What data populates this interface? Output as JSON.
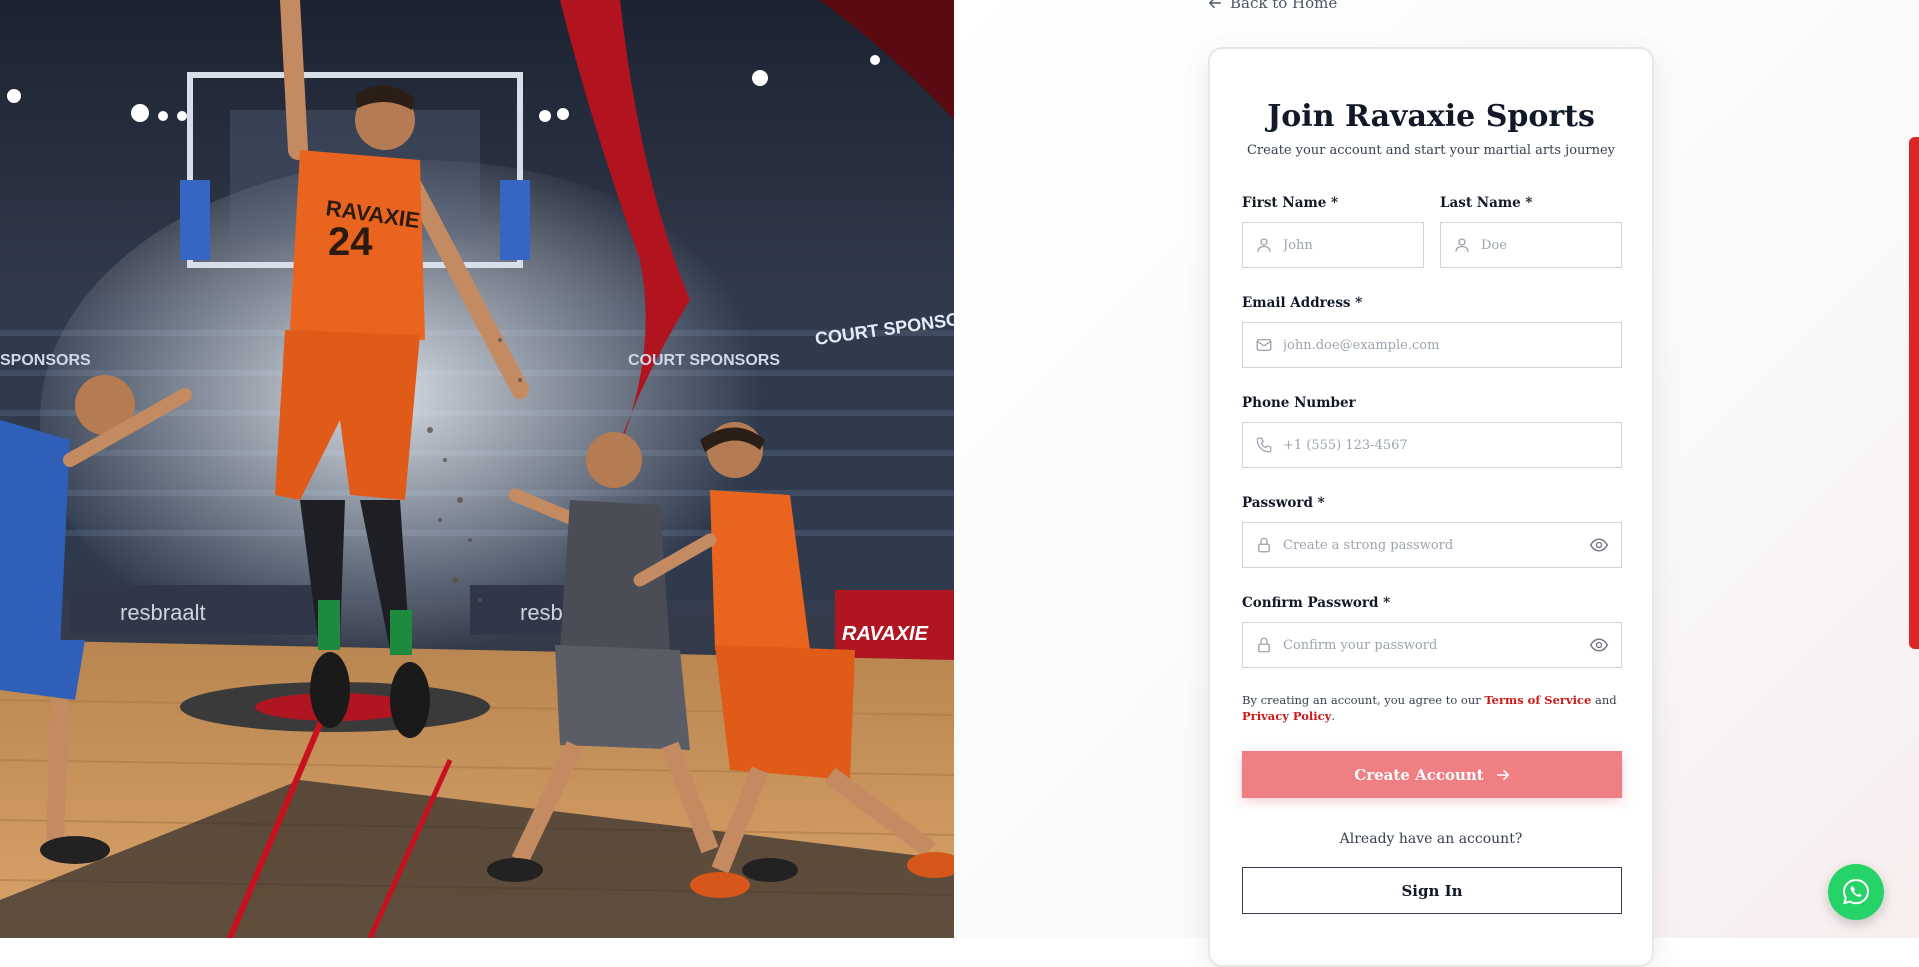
{
  "hero": {
    "jersey_text": "RAVAXIE",
    "jersey_number": "24",
    "banner_court_sponsors": "COURT SPONSORS",
    "banner_court_sponsors_2": "COURT SPONSORS",
    "banner_sponsors_left": "SPONSORS",
    "court_ad_1": "resbraalt",
    "court_ad_2": "resbr",
    "court_ad_3": "RAVAXIE",
    "colors": {
      "accent_red": "#dc2626",
      "jersey_orange": "#e8641f",
      "court_wood": "#c8935a"
    }
  },
  "nav": {
    "back_label": "Back to Home",
    "back_icon": "arrow-left-icon"
  },
  "form": {
    "title": "Join Ravaxie Sports",
    "subtitle": "Create your account and start your martial arts journey",
    "first_name": {
      "label": "First Name *",
      "placeholder": "John",
      "icon": "user-icon"
    },
    "last_name": {
      "label": "Last Name *",
      "placeholder": "Doe",
      "icon": "user-icon"
    },
    "email": {
      "label": "Email Address *",
      "placeholder": "john.doe@example.com",
      "icon": "mail-icon"
    },
    "phone": {
      "label": "Phone Number",
      "placeholder": "+1 (555) 123-4567",
      "icon": "phone-icon"
    },
    "password": {
      "label": "Password *",
      "placeholder": "Create a strong password",
      "icon": "lock-icon"
    },
    "confirm_password": {
      "label": "Confirm Password *",
      "placeholder": "Confirm your password",
      "icon": "lock-icon"
    },
    "terms_prefix": "By creating an account, you agree to our ",
    "terms_link": "Terms of Service",
    "terms_and": " and ",
    "privacy_link": "Privacy Policy",
    "terms_suffix": ".",
    "create_button": "Create Account",
    "have_account": "Already have an account?",
    "signin_button": "Sign In"
  },
  "colors": {
    "primary": "#dc2626",
    "create_button_bg": "#ef7f82",
    "whatsapp": "#25d366"
  },
  "floating": {
    "whatsapp_icon": "whatsapp-icon"
  }
}
